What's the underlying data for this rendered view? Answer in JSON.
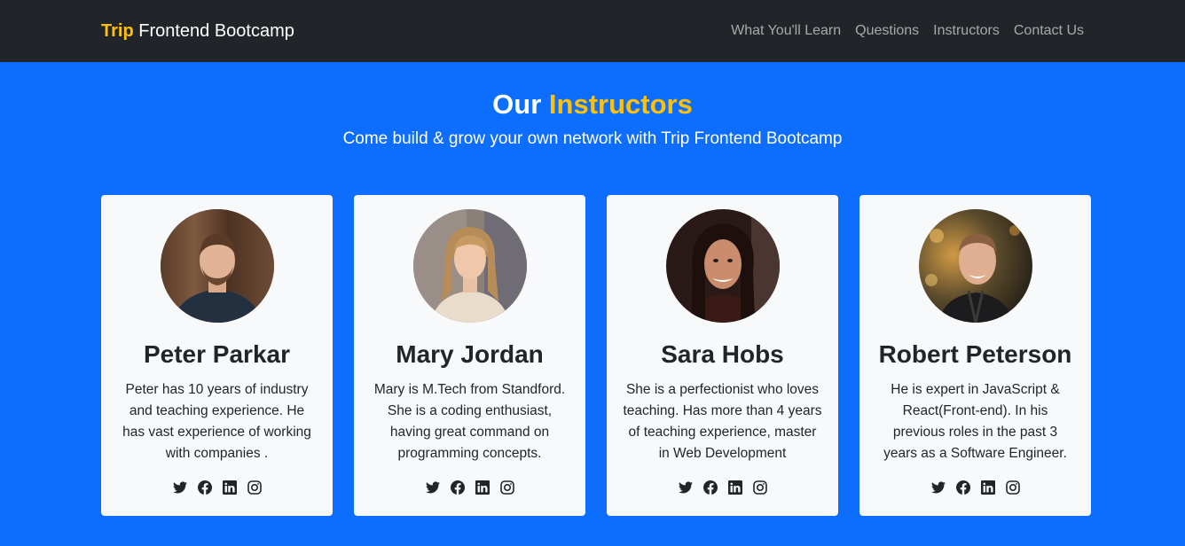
{
  "navbar": {
    "brand_accent": "Trip",
    "brand_rest": " Frontend Bootcamp",
    "links": [
      "What You'll Learn",
      "Questions",
      "Instructors",
      "Contact Us"
    ]
  },
  "section": {
    "title_plain": "Our ",
    "title_accent": "Instructors",
    "subtitle": "Come build & grow your own network with Trip Frontend Bootcamp"
  },
  "instructors": [
    {
      "name": "Peter Parkar",
      "bio": "Peter has 10 years of industry and teaching experience. He has vast experience of working with companies .",
      "photo_icon": "man-beard-photo"
    },
    {
      "name": "Mary Jordan",
      "bio": "Mary is M.Tech from Standford. She is a coding enthusiast, having great command on programming concepts.",
      "photo_icon": "woman-blonde-photo"
    },
    {
      "name": "Sara Hobs",
      "bio": "She is a perfectionist who loves teaching. Has more than 4 years of teaching experience, master in Web Development",
      "photo_icon": "woman-dark-hair-photo"
    },
    {
      "name": "Robert Peterson",
      "bio": "He is expert in JavaScript & React(Front-end). In his previous roles in the past 3 years as a Software Engineer.",
      "photo_icon": "man-smiling-photo"
    }
  ],
  "social_icons": [
    "twitter-icon",
    "facebook-icon",
    "linkedin-icon",
    "instagram-icon"
  ],
  "colors": {
    "navbar_bg": "#212529",
    "accent": "#ffc107",
    "section_bg": "#0d6efd",
    "card_bg": "#f8f9fa"
  }
}
